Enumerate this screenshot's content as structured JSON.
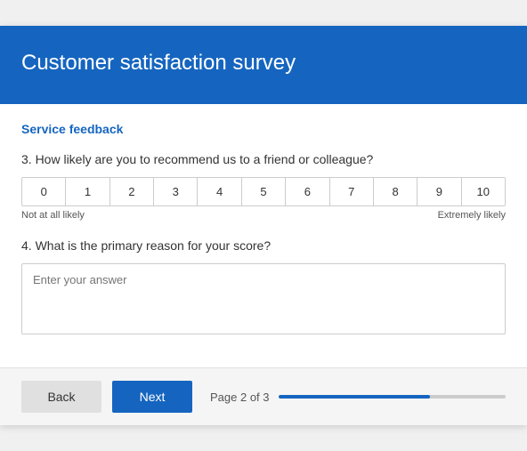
{
  "header": {
    "title": "Customer satisfaction survey"
  },
  "section": {
    "label": "Service feedback"
  },
  "questions": {
    "q3": {
      "label": "3. How likely are you to recommend us to a friend or colleague?",
      "scale": [
        0,
        1,
        2,
        3,
        4,
        5,
        6,
        7,
        8,
        9,
        10
      ],
      "low_label": "Not at all likely",
      "high_label": "Extremely likely"
    },
    "q4": {
      "label": "4. What is the primary reason for your score?",
      "placeholder": "Enter your answer"
    }
  },
  "footer": {
    "back_label": "Back",
    "next_label": "Next",
    "page_text": "Page 2 of 3",
    "progress_percent": 66.6
  }
}
